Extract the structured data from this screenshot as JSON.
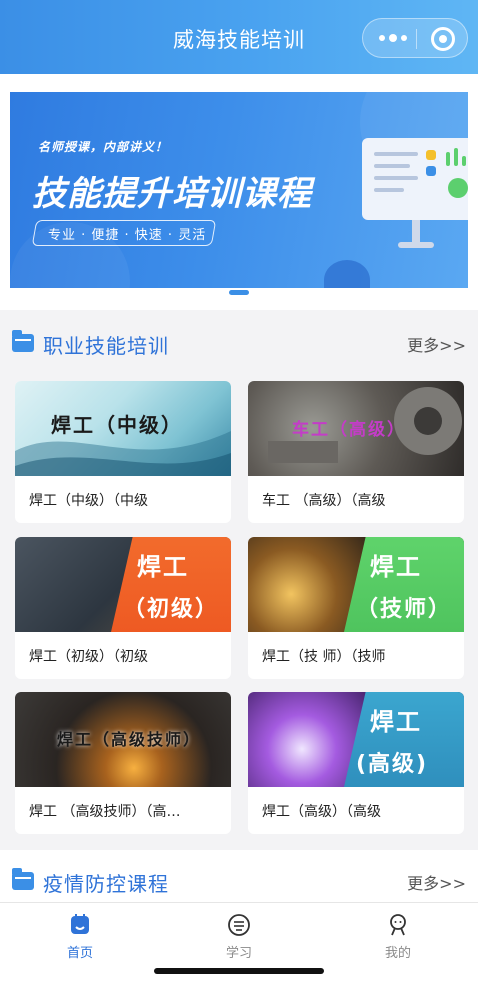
{
  "navbar": {
    "title": "威海技能培训"
  },
  "banner": {
    "tagline": "名师授课，内部讲义！",
    "title": "技能提升培训课程",
    "subtitle": "专业 · 便捷 · 快速 · 灵活"
  },
  "section_vocational": {
    "title": "职业技能培训",
    "more": "更多>>"
  },
  "courses": [
    {
      "thumb_text": "焊工（中级）",
      "caption": "焊工（中级）（中级"
    },
    {
      "thumb_text": "车工（高级）",
      "caption": "车工 （高级）（高级"
    },
    {
      "thumb_line1": "焊工",
      "thumb_line2": "（初级）",
      "caption": "焊工（初级）（初级"
    },
    {
      "thumb_line1": "焊工",
      "thumb_line2": "（技师）",
      "caption": "焊工（技 师）（技师"
    },
    {
      "thumb_text": "焊工（高级技师）",
      "caption": "焊工 （高级技师）（高…"
    },
    {
      "thumb_line1": "焊工",
      "thumb_line2": "(高级)",
      "caption": "焊工（高级）（高级"
    }
  ],
  "section_epidemic": {
    "title": "疫情防控课程",
    "more": "更多>>"
  },
  "tabbar": {
    "items": [
      {
        "label": "首页",
        "icon": "home-icon",
        "active": true
      },
      {
        "label": "学习",
        "icon": "study-icon",
        "active": false
      },
      {
        "label": "我的",
        "icon": "profile-icon",
        "active": false
      }
    ]
  },
  "colors": {
    "accent": "#2f73d8",
    "nav": "#4aa3f0",
    "orange": "#f06a2b",
    "green": "#5ccf6e",
    "teal": "#3a9fc9"
  }
}
